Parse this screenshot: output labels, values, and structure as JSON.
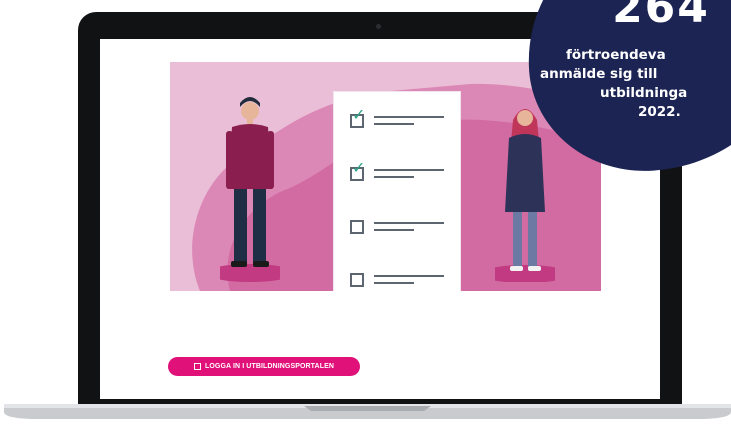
{
  "hero": {
    "checklist": [
      {
        "checked": true
      },
      {
        "checked": true
      },
      {
        "checked": false
      },
      {
        "checked": false
      }
    ],
    "check_symbol": "✓"
  },
  "button": {
    "label": "LOGGA IN I UTBILDNINGSPORTALEN",
    "icon": "external-link-icon"
  },
  "stat": {
    "number": "264",
    "line1": "förtroendeva",
    "line2": "anmälde sig till",
    "line3": "utbildninga",
    "line4": "2022."
  },
  "colors": {
    "brand_pink": "#e0127a",
    "badge_navy": "#1c2454",
    "hero_pink": "#eabed6",
    "check_green": "#2ea58a"
  }
}
